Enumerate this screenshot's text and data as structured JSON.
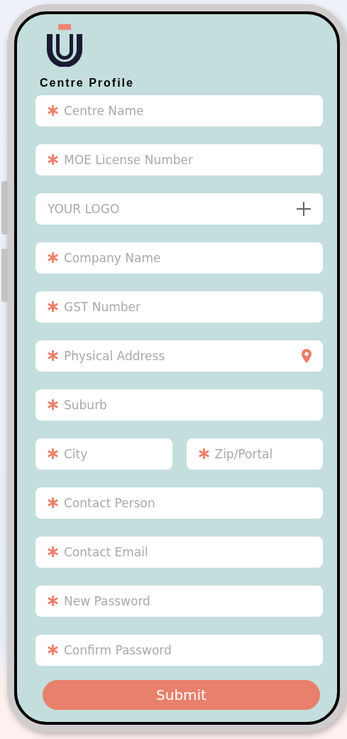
{
  "title": "Centre Profile",
  "rows": [
    {
      "fields": [
        {
          "placeholder": "Centre Name",
          "required": true
        }
      ]
    },
    {
      "fields": [
        {
          "placeholder": "MOE License Number",
          "required": true
        }
      ]
    },
    {
      "fields": [
        {
          "placeholder": "YOUR LOGO",
          "required": false,
          "kind": "upload"
        }
      ]
    },
    {
      "fields": [
        {
          "placeholder": "Company Name",
          "required": true
        }
      ]
    },
    {
      "fields": [
        {
          "placeholder": "GST Number",
          "required": true
        }
      ]
    },
    {
      "fields": [
        {
          "placeholder": "Physical Address",
          "required": true,
          "kind": "location"
        }
      ]
    },
    {
      "fields": [
        {
          "placeholder": "Suburb",
          "required": true
        }
      ]
    },
    {
      "fields": [
        {
          "placeholder": "City",
          "required": true
        },
        {
          "placeholder": "Zip/Portal",
          "required": true
        }
      ]
    },
    {
      "fields": [
        {
          "placeholder": "Contact Person",
          "required": true
        }
      ]
    },
    {
      "fields": [
        {
          "placeholder": "Contact Email",
          "required": true
        }
      ]
    },
    {
      "fields": [
        {
          "placeholder": "New Password",
          "required": true
        }
      ]
    },
    {
      "fields": [
        {
          "placeholder": "Confirm Password",
          "required": true
        }
      ]
    }
  ],
  "submit": "Submit"
}
